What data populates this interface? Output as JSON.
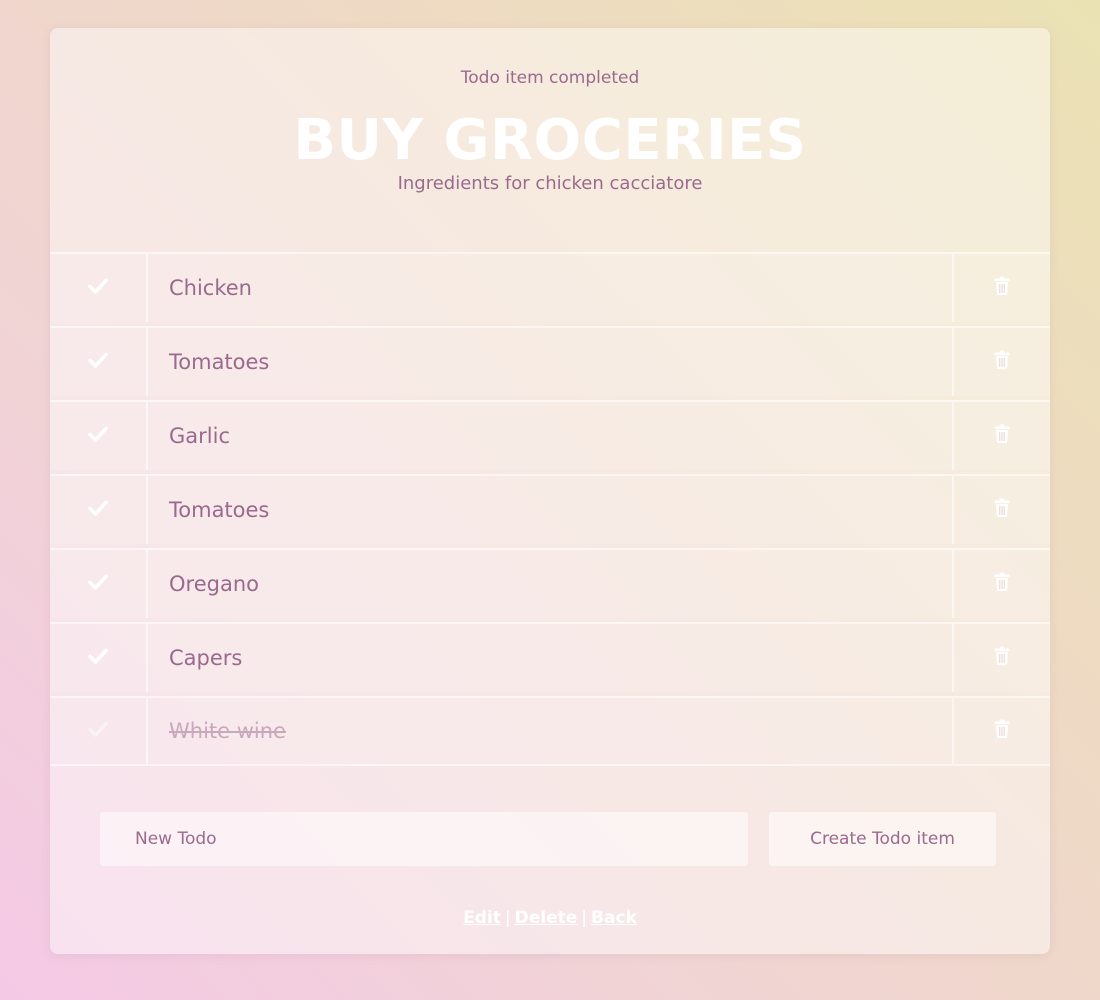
{
  "flash": "Todo item completed",
  "list": {
    "title": "BUY GROCERIES",
    "description": "Ingredients for chicken cacciatore"
  },
  "items": [
    {
      "label": "Chicken",
      "completed": false
    },
    {
      "label": "Tomatoes",
      "completed": false
    },
    {
      "label": "Garlic",
      "completed": false
    },
    {
      "label": "Tomatoes",
      "completed": false
    },
    {
      "label": "Oregano",
      "completed": false
    },
    {
      "label": "Capers",
      "completed": false
    },
    {
      "label": "White wine",
      "completed": true
    }
  ],
  "form": {
    "placeholder": "New Todo",
    "submit_label": "Create Todo item"
  },
  "links": {
    "edit": "Edit",
    "separator": "|",
    "delete": "Delete",
    "back": "Back"
  },
  "icons": {
    "check": "check-icon",
    "delete": "trash-icon"
  },
  "colors": {
    "accent_text": "#9a6a8e",
    "title": "#ffffff",
    "completed_text": "#c9a8bd"
  }
}
